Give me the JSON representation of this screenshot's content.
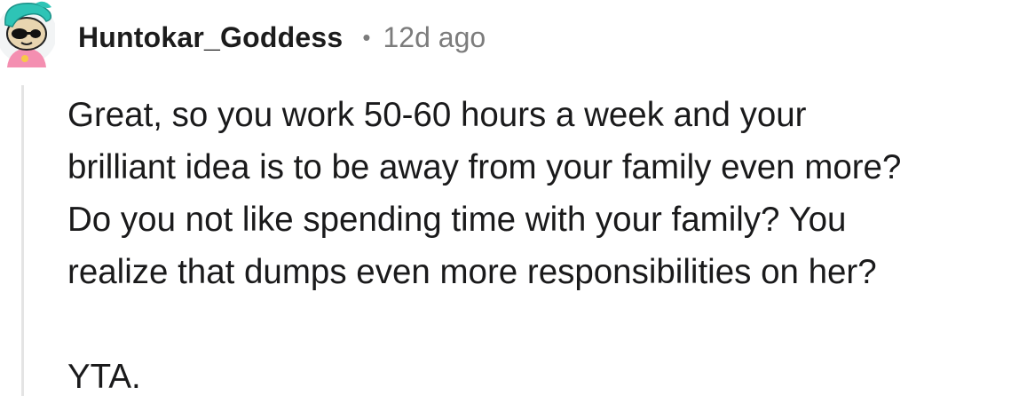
{
  "comment": {
    "author": "Huntokar_Goddess",
    "separator": "•",
    "timestamp": "12d ago",
    "avatar_icon": "snoo-avatar-teal-hair-sunglasses-icon",
    "body_lines": [
      "Great, so you work 50-60 hours a week and your",
      "brilliant idea is to be away from your family even more?",
      "Do you not like spending time with your family? You",
      "realize that dumps even more responsibilities on her?"
    ],
    "body_closing": "YTA.",
    "colors": {
      "text": "#1a1a1b",
      "meta": "#7c7c7c",
      "thread_line": "#e4e4e4",
      "avatar_hair": "#2ec4b6",
      "avatar_shirt": "#f48fb1"
    }
  }
}
